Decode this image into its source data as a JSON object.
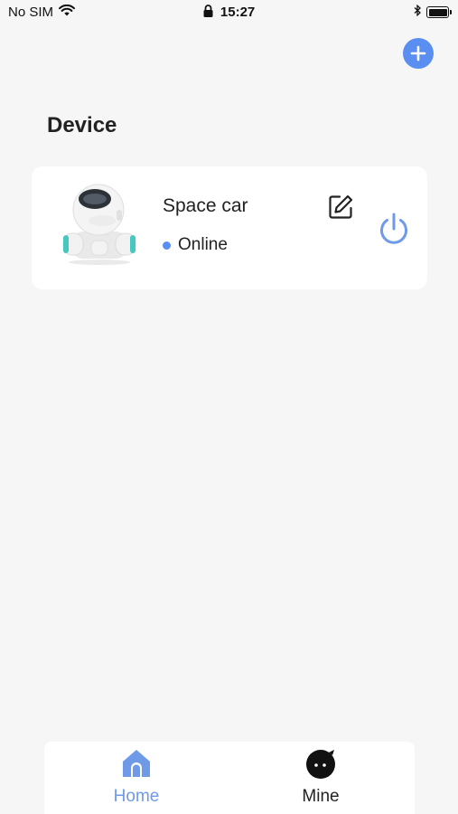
{
  "status_bar": {
    "carrier": "No SIM",
    "time": "15:27",
    "icons": [
      "wifi-icon",
      "lock-icon",
      "bluetooth-icon",
      "battery-icon"
    ]
  },
  "header": {
    "add_icon": "plus-icon"
  },
  "page": {
    "title": "Device"
  },
  "device_card": {
    "name": "Space car",
    "status": "Online",
    "status_color": "#5a8ef0",
    "icons": [
      "robot-device-image",
      "edit-icon",
      "power-icon"
    ]
  },
  "tab_bar": {
    "tabs": [
      {
        "label": "Home",
        "icon": "home-icon",
        "active": true
      },
      {
        "label": "Mine",
        "icon": "mine-face-icon",
        "active": false
      }
    ],
    "active_color": "#6f9ae8"
  },
  "colors": {
    "accent": "#5a8ef0",
    "background": "#f6f6f6",
    "card": "#ffffff"
  }
}
